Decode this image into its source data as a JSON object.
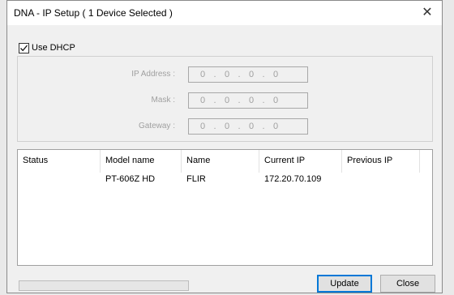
{
  "window": {
    "title": "DNA - IP Setup ( 1 Device Selected )",
    "close_glyph": "✕"
  },
  "dhcp": {
    "label": "Use DHCP",
    "checked": true
  },
  "ip_settings": {
    "ip_address": {
      "label": "IP Address :",
      "octets": [
        "0",
        "0",
        "0",
        "0"
      ]
    },
    "mask": {
      "label": "Mask :",
      "octets": [
        "0",
        "0",
        "0",
        "0"
      ]
    },
    "gateway": {
      "label": "Gateway :",
      "octets": [
        "0",
        "0",
        "0",
        "0"
      ]
    },
    "separator": "."
  },
  "device_list": {
    "columns": [
      "Status",
      "Model name",
      "Name",
      "Current IP",
      "Previous IP"
    ],
    "rows": [
      {
        "status": "",
        "model_name": "PT-606Z HD",
        "name": "FLIR",
        "current_ip": "172.20.70.109",
        "previous_ip": ""
      }
    ]
  },
  "progress": {
    "value": 0
  },
  "buttons": {
    "update": "Update",
    "close": "Close"
  },
  "colors": {
    "window_bg": "#f0f0f0",
    "titlebar_bg": "#ffffff",
    "disabled_text": "#a0a0a0",
    "focus_border": "#0078d7"
  }
}
